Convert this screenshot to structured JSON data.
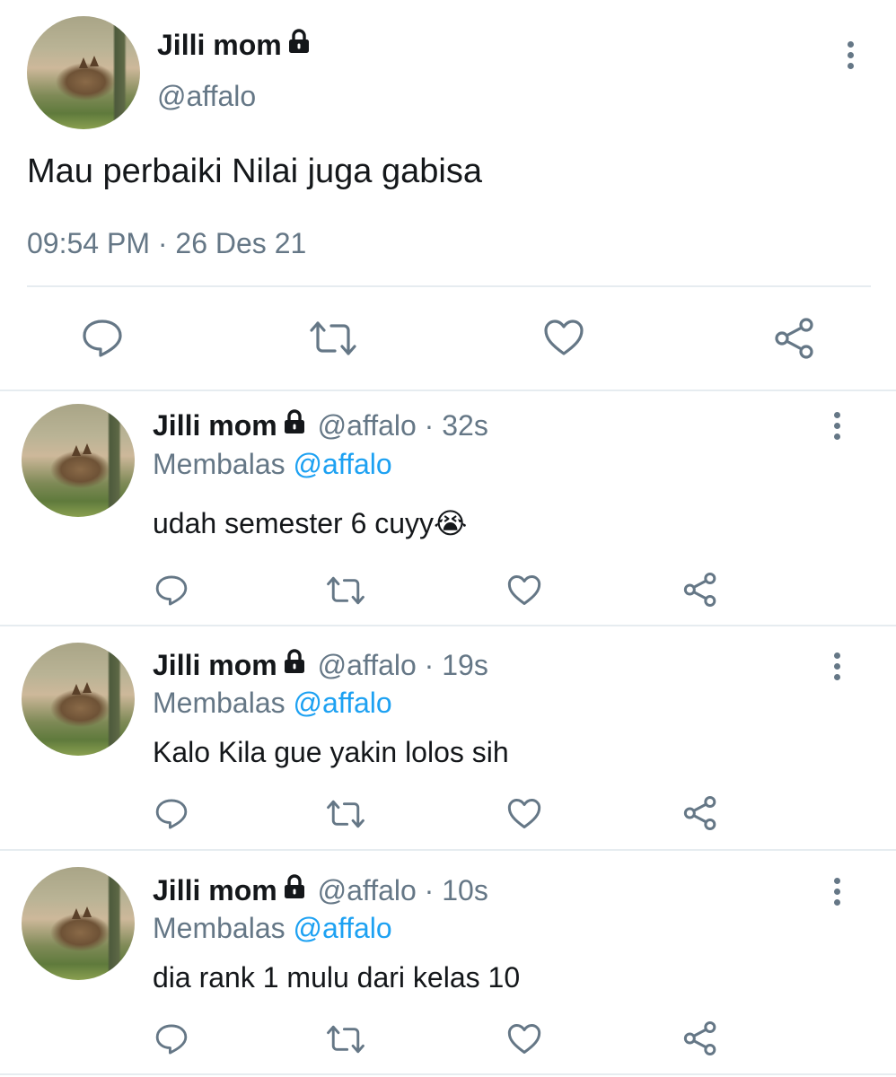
{
  "main_tweet": {
    "display_name": "Jilli mom",
    "handle": "@affalo",
    "text": "Mau perbaiki Nilai juga gabisa",
    "timestamp": "09:54 PM · 26 Des 21",
    "icons": [
      "lock-icon",
      "more-icon",
      "reply-icon",
      "retweet-icon",
      "like-icon",
      "share-icon"
    ]
  },
  "replies": [
    {
      "display_name": "Jilli mom",
      "handle": "@affalo",
      "time": "· 32s",
      "replying_label": "Membalas",
      "replying_to": "@affalo",
      "text": "udah semester 6 cuyy😭"
    },
    {
      "display_name": "Jilli mom",
      "handle": "@affalo",
      "time": "· 19s",
      "replying_label": "Membalas",
      "replying_to": "@affalo",
      "text": "Kalo Kila gue yakin lolos sih"
    },
    {
      "display_name": "Jilli mom",
      "handle": "@affalo",
      "time": "· 10s",
      "replying_label": "Membalas",
      "replying_to": "@affalo",
      "text": "dia rank 1 mulu dari kelas 10"
    }
  ],
  "colors": {
    "text": "#14171a",
    "secondary": "#657786",
    "link": "#1da1f2",
    "divider": "#e6ecf0"
  }
}
